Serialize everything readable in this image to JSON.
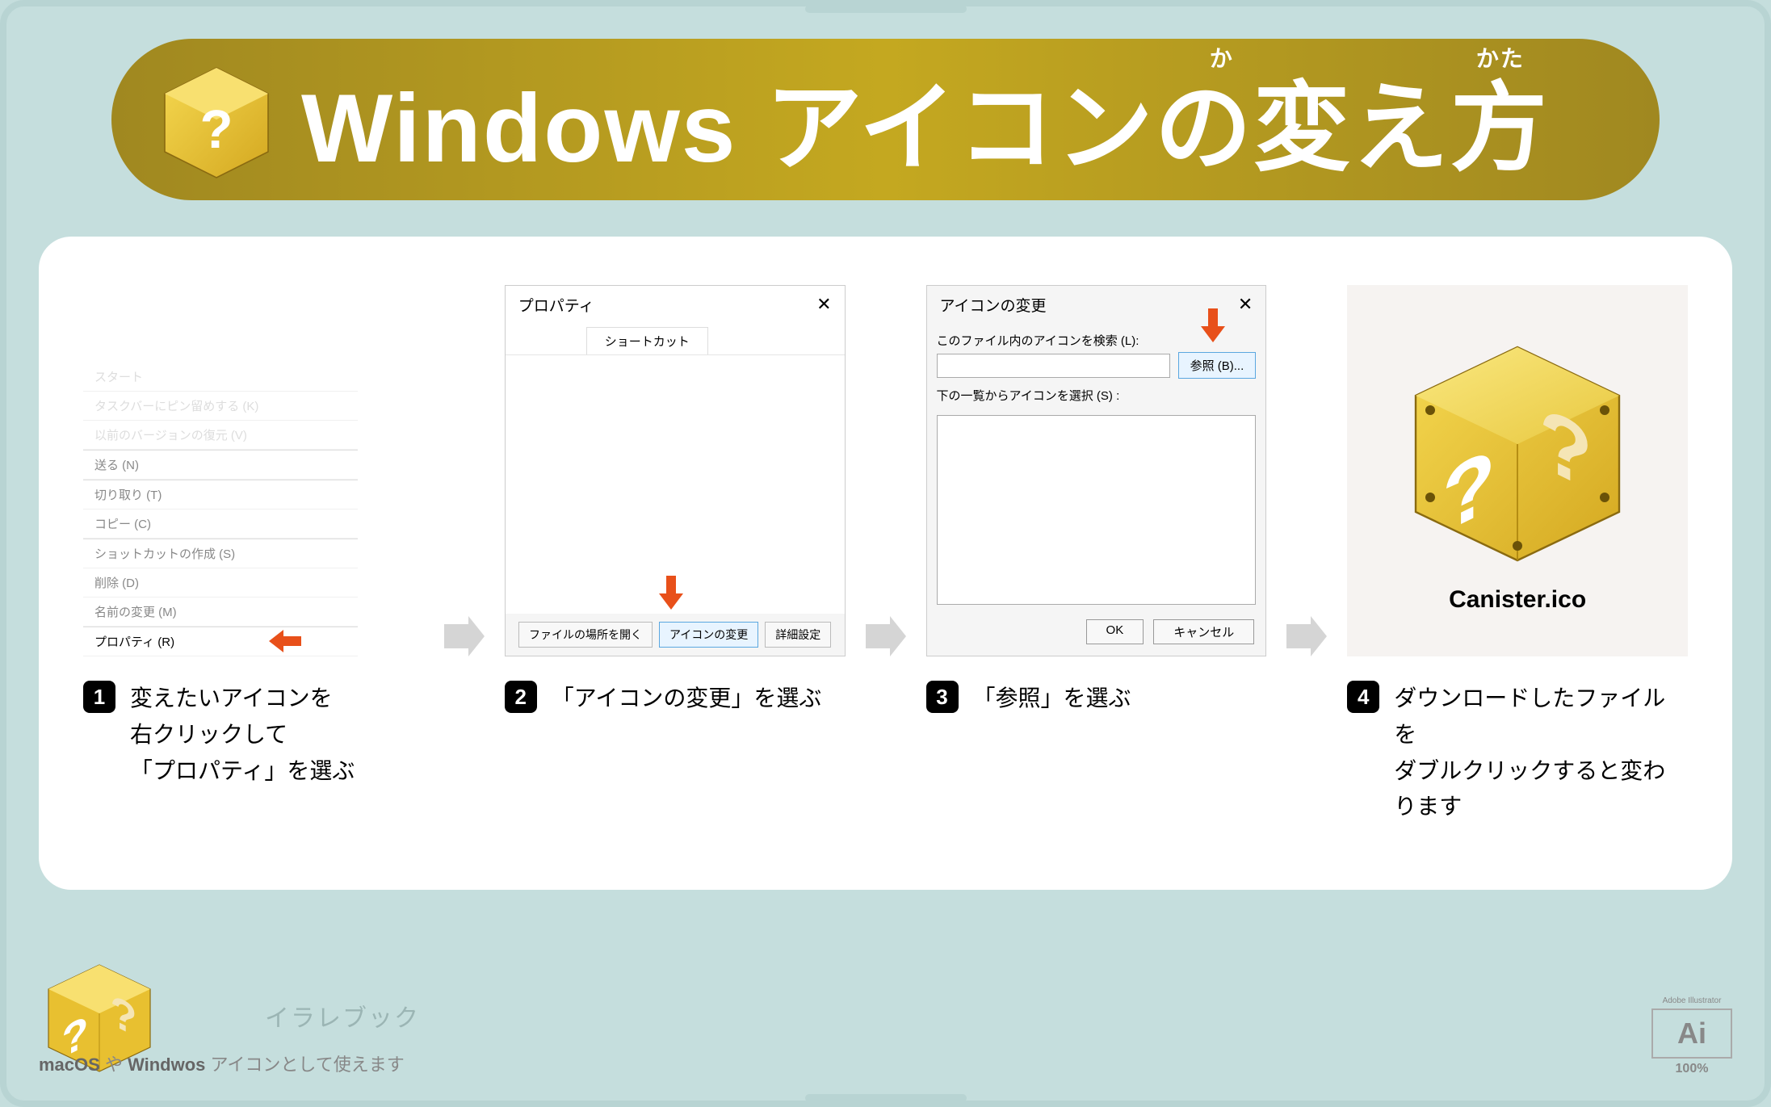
{
  "title": {
    "main": "Windows アイコンの変え方",
    "furigana1": "か",
    "furigana2": "かた"
  },
  "steps": [
    {
      "num": "1",
      "text": "変えたいアイコンを\n右クリックして\n「プロパティ」を選ぶ",
      "ctx": {
        "items_faded": [
          "スタート",
          "タスクバーにピン留めする (K)",
          "以前のバージョンの復元 (V)"
        ],
        "items": [
          "送る (N)",
          "切り取り (T)",
          "コピー (C)",
          "ショットカットの作成 (S)",
          "削除 (D)",
          "名前の変更 (M)"
        ],
        "selected": "プロパティ (R)"
      }
    },
    {
      "num": "2",
      "text": "「アイコンの変更」を選ぶ",
      "dialog": {
        "title": "プロパティ",
        "tab": "ショートカット",
        "btn1": "ファイルの場所を開く",
        "btn2": "アイコンの変更",
        "btn3": "詳細設定"
      }
    },
    {
      "num": "3",
      "text": "「参照」を選ぶ",
      "dialog": {
        "title": "アイコンの変更",
        "label1": "このファイル内のアイコンを検索 (L):",
        "browse": "参照 (B)...",
        "label2": "下の一覧からアイコンを選択 (S) :",
        "ok": "OK",
        "cancel": "キャンセル"
      }
    },
    {
      "num": "4",
      "text": "ダウンロードしたファイルを\nダブルクリックすると変わります",
      "filename": "Canister.ico"
    }
  ],
  "footer": {
    "brand": "イラレブック",
    "note_prefix": "macOS",
    "note_mid": " や ",
    "note_bold2": "Windwos",
    "note_suffix": " アイコンとして使えます",
    "ai_label": "Adobe Illustrator",
    "ai_text": "Ai",
    "ai_pct": "100%"
  }
}
